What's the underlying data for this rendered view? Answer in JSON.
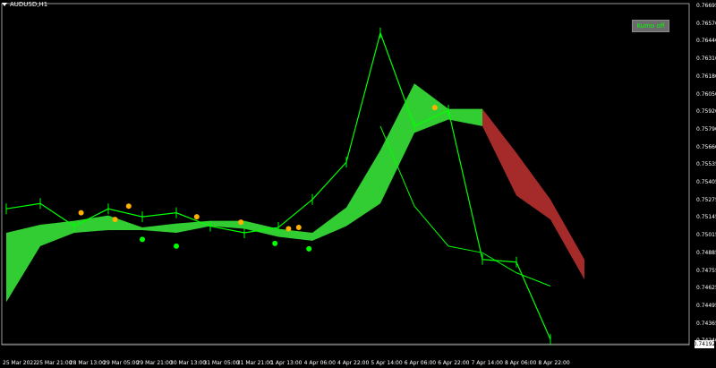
{
  "chart_window": {
    "symbol_label": "AUDUSD,H1",
    "kumo_button_label": "Kumo off",
    "current_price": "0.74192",
    "colors": {
      "background": "#000000",
      "candles": "#00ff00",
      "kumo_bull": "#32cd32",
      "kumo_bear": "#a52a2a",
      "chikou": "#00ff00",
      "fractal_marker": "#ffb000"
    }
  },
  "chart_data": {
    "type": "line",
    "title": "",
    "xlabel": "",
    "ylabel": "",
    "y_ticks": [
      "0.76695",
      "0.76570",
      "0.76440",
      "0.76310",
      "0.76180",
      "0.76050",
      "0.75920",
      "0.75790",
      "0.75660",
      "0.75535",
      "0.75405",
      "0.75275",
      "0.75145",
      "0.75015",
      "0.74885",
      "0.74755",
      "0.74625",
      "0.74495",
      "0.74365",
      "0.74240"
    ],
    "x_ticks": [
      "25 Mar 2022",
      "25 Mar 21:00",
      "28 Mar 13:00",
      "29 Mar 05:00",
      "29 Mar 21:00",
      "30 Mar 13:00",
      "31 Mar 05:00",
      "31 Mar 21:00",
      "1 Apr 13:00",
      "4 Apr 06:00",
      "4 Apr 22:00",
      "5 Apr 14:00",
      "6 Apr 06:00",
      "6 Apr 22:00",
      "7 Apr 14:00",
      "8 Apr 06:00",
      "8 Apr 22:00"
    ],
    "ylim": [
      0.7416,
      0.7672
    ],
    "series": [
      {
        "name": "",
        "style": "price",
        "x": [
          0,
          1,
          2,
          3,
          4,
          5,
          6,
          7,
          8,
          9,
          10,
          11,
          12,
          13,
          14,
          15,
          16
        ],
        "values": [
          0.7518,
          0.7522,
          0.7505,
          0.7518,
          0.7512,
          0.7515,
          0.7505,
          0.75,
          0.7504,
          0.7525,
          0.7553,
          0.765,
          0.758,
          0.7592,
          0.748,
          0.7478,
          0.742
        ]
      },
      {
        "name": "",
        "style": "kumo_top",
        "x": [
          0,
          1,
          2,
          3,
          4,
          5,
          6,
          7,
          8,
          9,
          10,
          11,
          12,
          13,
          14,
          15,
          16,
          17
        ],
        "values": [
          0.75,
          0.7506,
          0.7509,
          0.7513,
          0.7504,
          0.7507,
          0.7509,
          0.7509,
          0.7503,
          0.75,
          0.7519,
          0.7562,
          0.7612,
          0.7593,
          0.7593,
          0.756,
          0.7525,
          0.748
        ]
      },
      {
        "name": "",
        "style": "kumo_bottom",
        "x": [
          0,
          1,
          2,
          3,
          4,
          5,
          6,
          7,
          8,
          9,
          10,
          11,
          12,
          13,
          14,
          15,
          16,
          17
        ],
        "values": [
          0.7448,
          0.749,
          0.75,
          0.7502,
          0.7502,
          0.75,
          0.7505,
          0.7503,
          0.7497,
          0.7494,
          0.7505,
          0.7522,
          0.7575,
          0.7585,
          0.758,
          0.7528,
          0.751,
          0.7465
        ]
      },
      {
        "name": "",
        "style": "chikou",
        "x": [
          11,
          12,
          13,
          14,
          15,
          16
        ],
        "values": [
          0.758,
          0.752,
          0.749,
          0.7485,
          0.747,
          0.746
        ]
      }
    ],
    "markers": [
      {
        "x": 2.2,
        "y": 0.7515,
        "kind": "up"
      },
      {
        "x": 3.2,
        "y": 0.751,
        "kind": "up"
      },
      {
        "x": 3.6,
        "y": 0.752,
        "kind": "up"
      },
      {
        "x": 4.0,
        "y": 0.7495,
        "kind": "down"
      },
      {
        "x": 5.0,
        "y": 0.749,
        "kind": "down"
      },
      {
        "x": 5.6,
        "y": 0.7512,
        "kind": "up"
      },
      {
        "x": 6.9,
        "y": 0.7508,
        "kind": "up"
      },
      {
        "x": 7.9,
        "y": 0.7492,
        "kind": "down"
      },
      {
        "x": 8.3,
        "y": 0.7503,
        "kind": "up"
      },
      {
        "x": 8.6,
        "y": 0.7504,
        "kind": "up"
      },
      {
        "x": 8.9,
        "y": 0.7488,
        "kind": "down"
      },
      {
        "x": 12.6,
        "y": 0.7594,
        "kind": "up"
      }
    ]
  }
}
